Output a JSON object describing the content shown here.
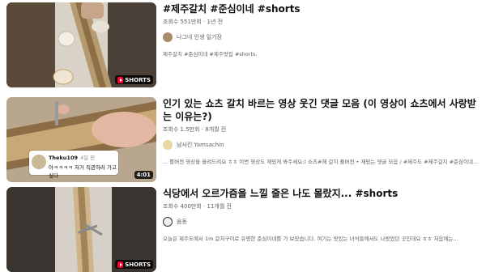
{
  "videos": [
    {
      "title": "#제주갈치 #준심이네 #shorts",
      "views": "조회수 551만회",
      "age": "1년 전",
      "channel": "나그네 인생 일기장",
      "description": "제주갈치 #준심이네 #제주맛집 #shorts.",
      "badge": "SHORTS"
    },
    {
      "title": "인기 있는 쇼츠 갈치 바르는 영상 웃긴 댓글 모음 (이 영상이 쇼츠에서 사랑받는 이유는?)",
      "views": "조회수 1.5만회",
      "age": "8개월 전",
      "channel": "냠사킨 Yamsachin",
      "description": "... 를버전 영상을 올려드려요 ㅎㅎ 이번 영상도 재밌게 봐주세요:) 쇼츠#해 갈치 풀버전 • 재밌는 댓글 모음 / #제주도 #제주갈치 #준심이네 · 남...",
      "duration": "4:01",
      "comment_user": "Theku109",
      "comment_time": "4일 전",
      "comment_text": "아ㅋㅋㅋㅋ 저거 직관하러 가고싶다"
    },
    {
      "title": "식당에서 오르가즘을 느낄 줄은 나도 몰랐지... #shorts",
      "views": "조회수 400만회",
      "age": "11개월 전",
      "channel": "음동",
      "description": "오늘은 제주도에서 1m 갈치구이로 유명한 준심이네를 가 보았습니다. 여기는 맛있는 녀석들에서도 나왔었던 곳인데요 ㅎㅎ 처음에는...",
      "badge": "SHORTS"
    }
  ]
}
